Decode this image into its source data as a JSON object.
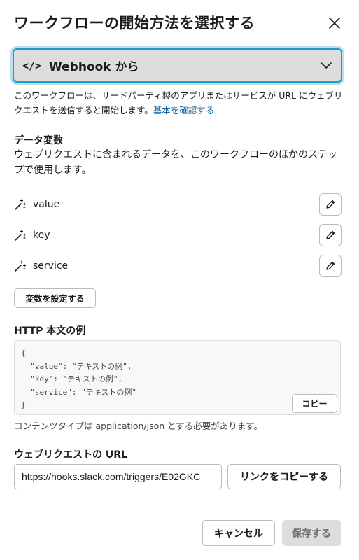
{
  "dialog": {
    "title": "ワークフローの開始方法を選択する",
    "close_icon": "close-icon"
  },
  "trigger": {
    "icon": "</>",
    "label": "Webhook から"
  },
  "description": {
    "text": "このワークフローは、サードパーティ製のアプリまたはサービスが URL にウェブリクエストを送信すると開始します。",
    "link": "基本を確認する"
  },
  "variables": {
    "title": "データ変数",
    "subtitle": "ウェブリクエストに含まれるデータを、このワークフローのほかのステップで使用します。",
    "items": [
      {
        "name": "value"
      },
      {
        "name": "key"
      },
      {
        "name": "service"
      }
    ],
    "set_button": "変数を設定する"
  },
  "http_body": {
    "title": "HTTP 本文の例",
    "code": "{\n  \"value\": \"テキストの例\",\n  \"key\": \"テキストの例\",\n  \"service\": \"テキストの例\"\n}",
    "copy_button": "コピー",
    "note": "コンテンツタイプは application/json とする必要があります。"
  },
  "webhook_url": {
    "title": "ウェブリクエストの URL",
    "value": "https://hooks.slack.com/triggers/E02GKC",
    "copy_button": "リンクをコピーする"
  },
  "footer": {
    "cancel": "キャンセル",
    "save": "保存する"
  },
  "colors": {
    "accent": "#1d9bd1",
    "link": "#1264a3",
    "select_bg": "#dddddd"
  }
}
